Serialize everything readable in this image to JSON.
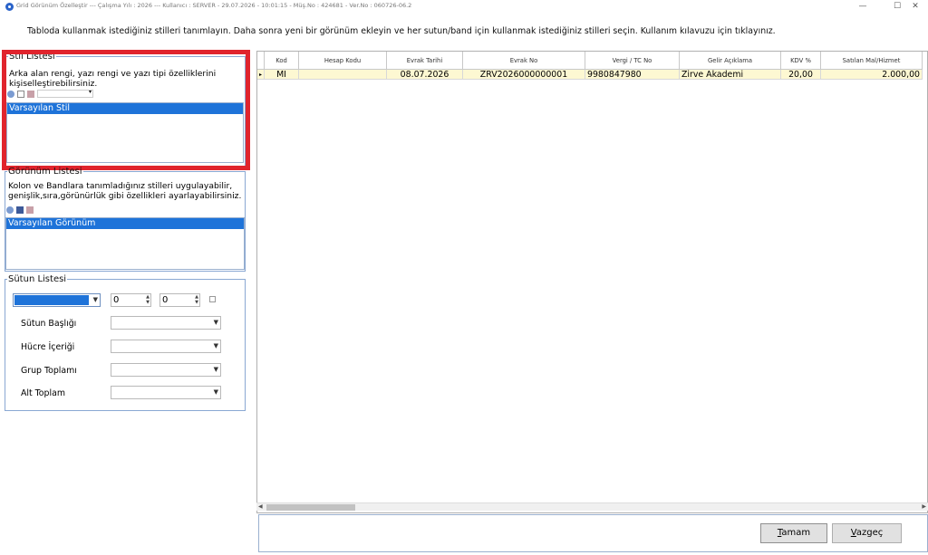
{
  "window": {
    "title": "Grid Görünüm Özelleştir   ---   Çalışma Yılı : 2026   ---   Kullanıcı : SERVER  -  29.07.2026  -  10:01:15  -  Müş.No : 424681  -  Ver.No : 060726-06.2",
    "minimize_glyph": "—",
    "maximize_glyph": "☐",
    "close_glyph": "✕"
  },
  "instruction": "Tabloda kullanmak istediğiniz stilleri tanımlayın.  Daha sonra  yeni bir görünüm ekleyin ve her sutun/band için kullanmak istediğiniz stilleri seçin.  Kullanım kılavuzu için tıklayınız.",
  "stil_listesi": {
    "legend": "Stil Listesi",
    "description": "Arka alan rengi, yazı rengi ve yazı tipi özelliklerini kişiselleştirebilirsiniz.",
    "items": [
      "Varsayılan Stil"
    ]
  },
  "gorunum_listesi": {
    "legend": "Görünüm Listesi",
    "description": "Kolon ve Bandlara tanımladığınız stilleri uygulayabilir, genişlik,sıra,görünürlük gibi özellikleri ayarlayabilirsiniz.",
    "items": [
      "Varsayılan Görünüm"
    ]
  },
  "sutun_listesi": {
    "legend": "Sütun Listesi",
    "spin1": "0",
    "spin2": "0",
    "labels": {
      "sutun_basligi": "Sütun Başlığı",
      "hucre_icerigi": "Hücre İçeriği",
      "grup_toplami": "Grup Toplamı",
      "alt_toplam": "Alt Toplam"
    }
  },
  "grid": {
    "columns": [
      "",
      "Kod",
      "Hesap Kodu",
      "Evrak Tarihi",
      "Evrak No",
      "Vergi / TC No",
      "Gelir Açıklama",
      "KDV %",
      "Satılan Mal/Hizmet"
    ],
    "row": [
      "▸",
      "MI",
      "",
      "08.07.2026",
      "ZRV2026000000001",
      "9980847980",
      "Zirve Akademi",
      "20,00",
      "2.000,00"
    ]
  },
  "buttons": {
    "ok_accel": "T",
    "ok_rest": "amam",
    "cancel_accel": "V",
    "cancel_rest": "azgeç"
  },
  "colors": {
    "highlight": "#e0242d",
    "selection": "#1e73d9",
    "row_bg": "#fdf8d2"
  }
}
